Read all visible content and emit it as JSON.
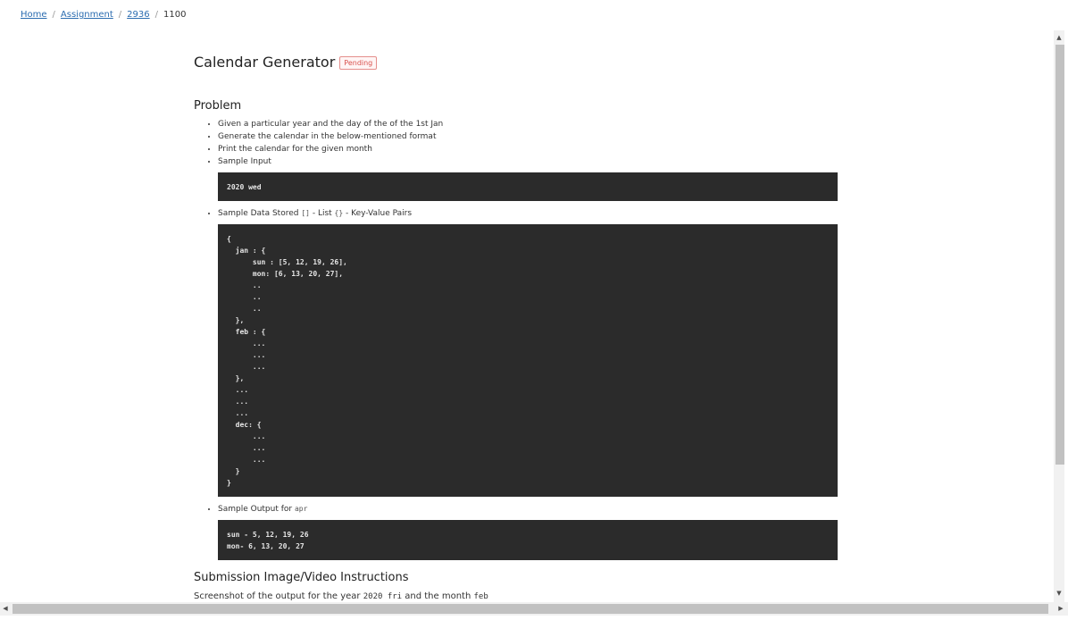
{
  "breadcrumb": {
    "items": [
      "Home",
      "Assignment",
      "2936"
    ],
    "current": "1100",
    "separator": "/"
  },
  "page": {
    "title": "Calendar Generator",
    "status": "Pending"
  },
  "problem": {
    "heading": "Problem",
    "bullets": [
      "Given a particular year and the day of the of the 1st Jan",
      "Generate the calendar in the below-mentioned format",
      "Print the calendar for the given month",
      "Sample Input"
    ],
    "sample_input_code": "2020 wed",
    "sample_data_label_prefix": "Sample Data Stored ",
    "sample_data_list_token": "[]",
    "sample_data_list_text": " - List ",
    "sample_data_kv_token": "{}",
    "sample_data_kv_text": " - Key-Value Pairs",
    "sample_data_code": "{\n  jan : {\n      sun : [5, 12, 19, 26],\n      mon: [6, 13, 20, 27],\n      ..\n      ..\n      ..\n  },\n  feb : {\n      ...\n      ...\n      ...\n  },\n  ...\n  ...\n  ...\n  dec: {\n      ...\n      ...\n      ...\n  }\n}",
    "sample_output_label": "Sample Output for ",
    "sample_output_token": "apr",
    "sample_output_code": "sun - 5, 12, 19, 26\nmon- 6, 13, 20, 27"
  },
  "submission": {
    "heading": "Submission Image/Video Instructions",
    "text_prefix": "Screenshot of the output for the year ",
    "year_code": "2020 fri",
    "text_middle": " and the month ",
    "month_code": "feb"
  },
  "icons": {
    "scroll_up": "triangle-up",
    "scroll_down": "triangle-down",
    "scroll_left": "triangle-left",
    "scroll_right": "triangle-right"
  }
}
